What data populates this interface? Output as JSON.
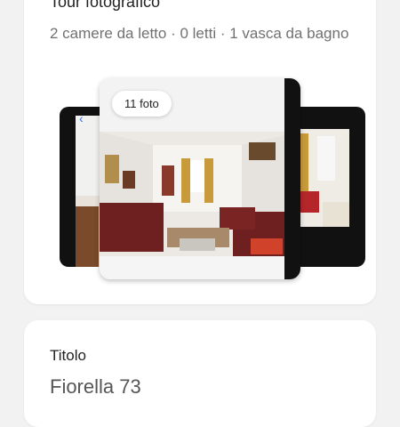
{
  "tour": {
    "heading": "Tour fotografico",
    "details": "2 camere da letto · 0 letti · 1 vasca da bagno",
    "photo_count": "11 foto",
    "back_icon": "chevron-left-icon"
  },
  "title_section": {
    "label": "Titolo",
    "value": "Fiorella 73"
  }
}
